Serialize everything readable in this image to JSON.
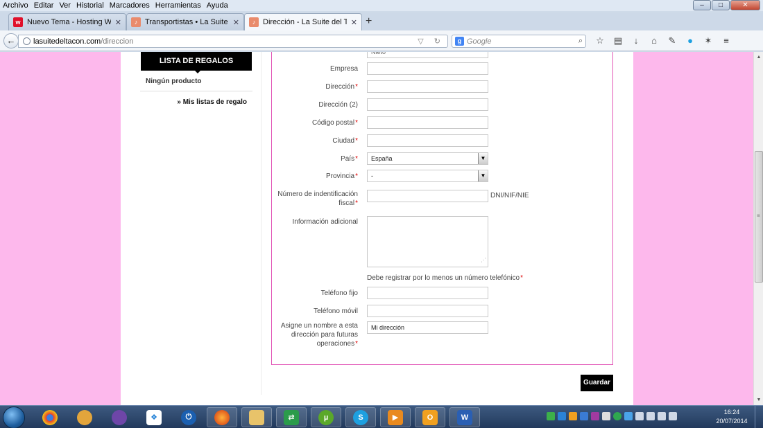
{
  "menu": [
    "Archivo",
    "Editar",
    "Ver",
    "Historial",
    "Marcadores",
    "Herramientas",
    "Ayuda"
  ],
  "tabs": [
    {
      "title": "Nuevo Tema - Hosting Wo...",
      "fav": "w",
      "fav_color": "#e0102a"
    },
    {
      "title": "Transportistas • La Suite de...",
      "fav": "",
      "fav_color": "#e06b4a"
    },
    {
      "title": "Dirección - La Suite del Tac...",
      "fav": "",
      "fav_color": "#e06b4a"
    }
  ],
  "url": {
    "host": "lasuitedeltacon.com",
    "path": "/direccion"
  },
  "search": {
    "engine": "Google",
    "placeholder": "Google"
  },
  "sidebar": {
    "heading": "LISTA DE REGALOS",
    "empty": "Ningún producto",
    "link": "» Mis listas de regalo"
  },
  "form": {
    "partial_value": "Nieto",
    "fields": {
      "empresa": {
        "label": "Empresa",
        "value": ""
      },
      "direccion": {
        "label": "Dirección",
        "value": ""
      },
      "direccion2": {
        "label": "Dirección (2)",
        "value": ""
      },
      "cp": {
        "label": "Código postal",
        "value": ""
      },
      "ciudad": {
        "label": "Ciudad",
        "value": ""
      },
      "pais": {
        "label": "País",
        "value": "España"
      },
      "provincia": {
        "label": "Provincia",
        "value": "-"
      },
      "nif_line1": {
        "label": "Número de indentificación"
      },
      "nif_line2": {
        "label": "fiscal"
      },
      "nif_suffix": "DNI/NIF/NIE",
      "info": {
        "label": "Información adicional"
      },
      "note": "Debe registrar por lo menos un número telefónico",
      "tel_fijo": {
        "label": "Teléfono fijo",
        "value": ""
      },
      "tel_movil": {
        "label": "Teléfono móvil",
        "value": ""
      },
      "alias_l1": "Asigne un nombre a esta",
      "alias_l2": "dirección para futuras",
      "alias_l3": "operaciones",
      "alias_value": "Mi dirección"
    },
    "required_mark": "*",
    "save_label": "Guardar"
  },
  "clock": {
    "time": "16:24",
    "date": "20/07/2014"
  },
  "accent_colors": {
    "page_bg": "#fdb8ec",
    "form_border": "#e255b6",
    "button": "#000000"
  }
}
